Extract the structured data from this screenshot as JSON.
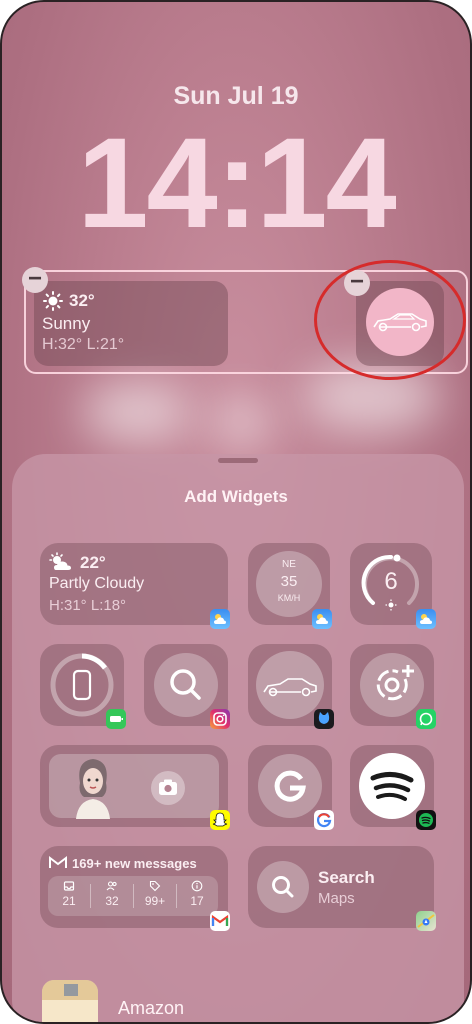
{
  "lock_screen": {
    "date": "Sun Jul 19",
    "time": "14:14",
    "weather_widget": {
      "temp": "32°",
      "condition": "Sunny",
      "range": "H:32° L:21°"
    }
  },
  "sheet": {
    "title": "Add Widgets",
    "weather": {
      "temp": "22°",
      "condition": "Partly Cloudy",
      "range": "H:31° L:18°"
    },
    "wind": {
      "direction": "NE",
      "speed": "35",
      "unit": "KM/H"
    },
    "uv": {
      "value": "6"
    },
    "gmail": {
      "header": "169+ new messages",
      "counts": [
        "21",
        "32",
        "99+",
        "17"
      ]
    },
    "maps": {
      "title": "Search",
      "subtitle": "Maps"
    },
    "amazon": {
      "label": "Amazon"
    }
  },
  "colors": {
    "wallpaper": "#bb7e8f",
    "highlight_circle": "#d62b2b",
    "spotify_green": "#1db954"
  }
}
